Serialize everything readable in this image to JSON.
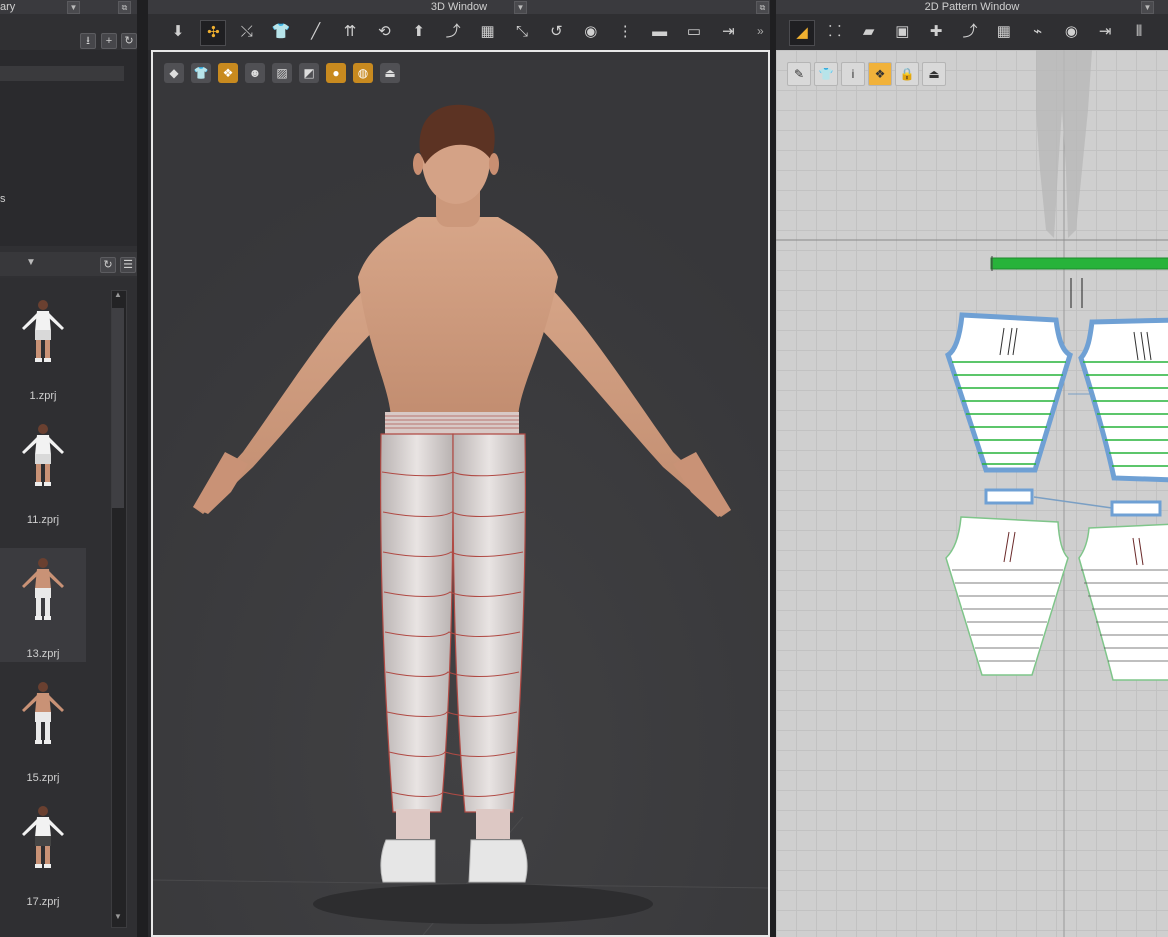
{
  "library": {
    "title_fragment": "ary",
    "tree_fragment": "s",
    "items": [
      {
        "label": "1.zprj",
        "figure": "tshirt-shorts"
      },
      {
        "label": "11.zprj",
        "figure": "longsleeve-shorts"
      },
      {
        "label": "13.zprj",
        "figure": "bare-pants"
      },
      {
        "label": "15.zprj",
        "figure": "bare-pants"
      },
      {
        "label": "17.zprj",
        "figure": "longsleeve-underwear"
      }
    ],
    "selected_index": 2,
    "scroll_up_glyph": "▲",
    "scroll_down_glyph": "▼"
  },
  "window3d": {
    "title": "3D Window",
    "toolbar_icons": [
      "select-mesh-icon",
      "move-icon",
      "gizmo-icon",
      "shirt-select-icon",
      "draw-line-icon",
      "flatten-icon",
      "tack-icon",
      "avatar-pose-icon",
      "fold-icon",
      "grid-icon",
      "measure-icon",
      "tape-icon",
      "pin-icon",
      "zipper-icon",
      "topstitch-icon",
      "iron-icon",
      "sewing-icon"
    ],
    "active_toolbar_index": 1,
    "view_icons": [
      "cube-icon",
      "garment-view-icon",
      "texture-icon",
      "avatar-view-icon",
      "render-mode-icon",
      "snapshot-icon",
      "skin-icon",
      "globe-icon",
      "export-icon"
    ]
  },
  "window2d": {
    "title": "2D Pattern Window",
    "toolbar_icons": [
      "select-pattern-icon",
      "transform-icon",
      "polygon-icon",
      "rectangle-icon",
      "dart-icon",
      "segment-sew-icon",
      "grid-icon",
      "trace-icon",
      "pin-icon",
      "sewing-icon",
      "stripes-icon"
    ],
    "active_toolbar_index": 0,
    "view_icons": [
      "brush-icon",
      "garment-icon",
      "info-icon",
      "texture-icon",
      "lock-garment-icon",
      "export-icon"
    ],
    "active_view_index": 3
  },
  "colors": {
    "sewing_line": "#27b33a",
    "pattern_outline_selected": "#6fa0d4",
    "panel_bg": "#303033",
    "accent_gold": "#c88a1f"
  }
}
